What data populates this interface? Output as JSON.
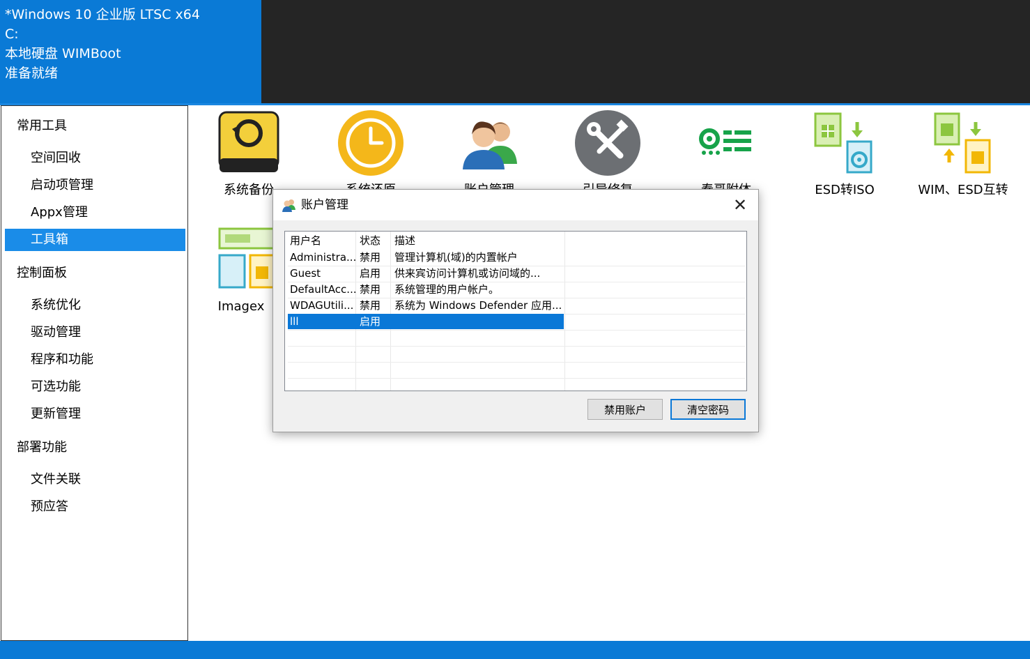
{
  "header": {
    "lines": [
      "*Windows 10 企业版 LTSC x64",
      "C:",
      "本地硬盘 WIMBoot",
      "准备就绪"
    ]
  },
  "sidebar": {
    "categories": [
      {
        "label": "常用工具",
        "items": [
          "空间回收",
          "启动项管理",
          "Appx管理",
          "工具箱"
        ]
      },
      {
        "label": "控制面板",
        "items": [
          "系统优化",
          "驱动管理",
          "程序和功能",
          "可选功能",
          "更新管理"
        ]
      },
      {
        "label": "部署功能",
        "items": [
          "文件关联",
          "预应答"
        ]
      }
    ],
    "active_item": "工具箱"
  },
  "tools": [
    {
      "label": "系统备份",
      "icon": "backup-drive-icon"
    },
    {
      "label": "系统还原",
      "icon": "restore-clock-icon"
    },
    {
      "label": "账户管理",
      "icon": "users-icon"
    },
    {
      "label": "引导修复",
      "icon": "wrench-screwdriver-icon"
    },
    {
      "label": "春哥附体",
      "icon": "settings-list-icon"
    },
    {
      "label": "ESD转ISO",
      "icon": "esd-to-iso-icon"
    },
    {
      "label": "WIM、ESD互转",
      "icon": "wim-esd-convert-icon"
    },
    {
      "label": "Imagex",
      "icon": "imagex-icon"
    }
  ],
  "dialog": {
    "title": "账户管理",
    "close_glyph": "✕",
    "columns": [
      "用户名",
      "状态",
      "描述"
    ],
    "rows": [
      {
        "name": "Administra...",
        "status": "禁用",
        "desc": "管理计算机(域)的内置帐户"
      },
      {
        "name": "Guest",
        "status": "启用",
        "desc": "供来宾访问计算机或访问域的..."
      },
      {
        "name": "DefaultAcc...",
        "status": "禁用",
        "desc": "系统管理的用户帐户。"
      },
      {
        "name": "WDAGUtili...",
        "status": "禁用",
        "desc": "系统为 Windows Defender 应用..."
      },
      {
        "name": "lll",
        "status": "启用",
        "desc": ""
      }
    ],
    "selected_row": 4,
    "buttons": {
      "disable": "禁用账户",
      "clear_password": "清空密码"
    }
  },
  "colors": {
    "accent": "#0a7ad6",
    "header_dark": "#252525",
    "selection": "#0a78d7"
  }
}
